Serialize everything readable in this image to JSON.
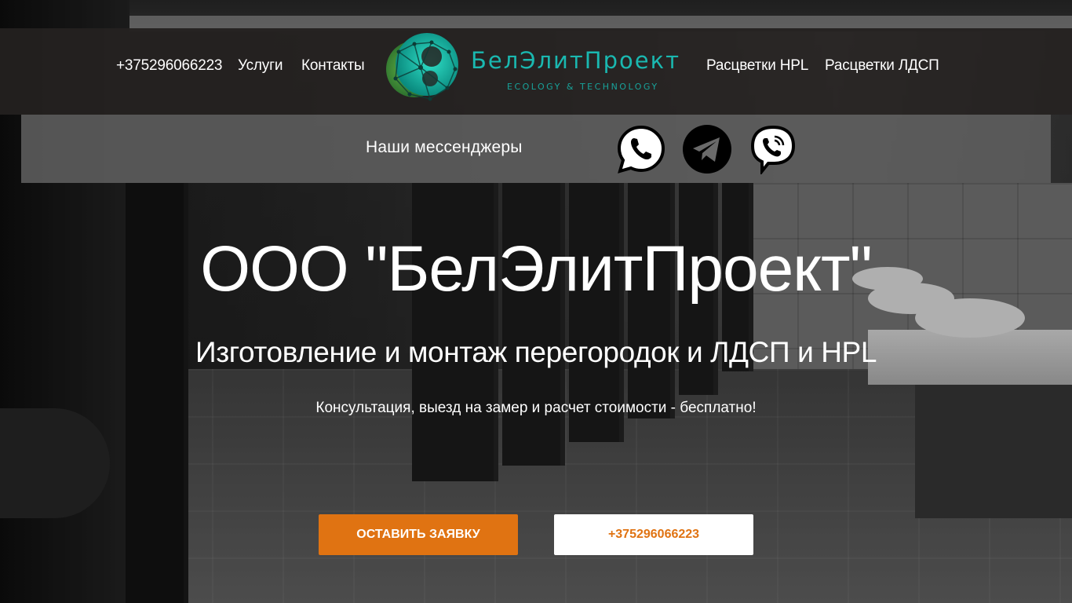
{
  "nav": {
    "phone": "+375296066223",
    "services": "Услуги",
    "contacts": "Контакты",
    "hpl_colors": "Расцветки HPL",
    "ldsp_colors": "Расцветки ЛДСП"
  },
  "logo": {
    "name": "БелЭлитПроект",
    "tagline": "ECOLOGY & TECHNOLOGY",
    "color": "#1ab8b0"
  },
  "messengers": {
    "label": "Наши мессенджеры",
    "items": [
      {
        "name": "whatsapp-icon"
      },
      {
        "name": "telegram-icon"
      },
      {
        "name": "viber-icon"
      }
    ]
  },
  "hero": {
    "title": "ООО \"БелЭлитПроект\"",
    "subtitle": "Изготовление и монтаж перегородок и ЛДСП и HPL",
    "note": "Консультация, выезд на замер и расчет стоимости - бесплатно!"
  },
  "buttons": {
    "request": "ОСТАВИТЬ ЗАЯВКУ",
    "phone": "+375296066223",
    "accent_color": "#e07312"
  }
}
